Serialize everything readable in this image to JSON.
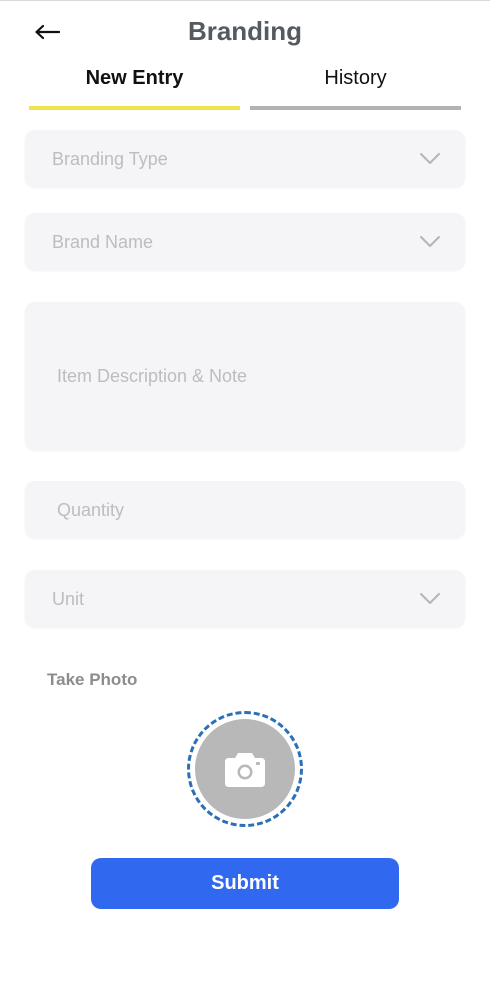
{
  "header": {
    "title": "Branding",
    "back_icon": "arrow-left-icon"
  },
  "tabs": [
    {
      "label": "New Entry",
      "active": true
    },
    {
      "label": "History",
      "active": false
    }
  ],
  "form": {
    "branding_type": {
      "placeholder": "Branding Type",
      "icon": "chevron-down-icon"
    },
    "brand_name": {
      "placeholder": "Brand Name",
      "icon": "chevron-down-icon"
    },
    "description": {
      "placeholder": "Item Description & Note"
    },
    "quantity": {
      "placeholder": "Quantity"
    },
    "unit": {
      "placeholder": "Unit",
      "icon": "chevron-down-icon"
    }
  },
  "photo": {
    "label": "Take Photo",
    "icon": "camera-icon"
  },
  "submit": {
    "label": "Submit"
  },
  "colors": {
    "accent_blue": "#3068f0",
    "active_tab_underline": "#f2e24c",
    "inactive_tab_underline": "#b2b2b2",
    "field_bg": "#f5f4f7",
    "placeholder_text": "#bdbcc2",
    "photo_ring": "#2a6fb8"
  }
}
